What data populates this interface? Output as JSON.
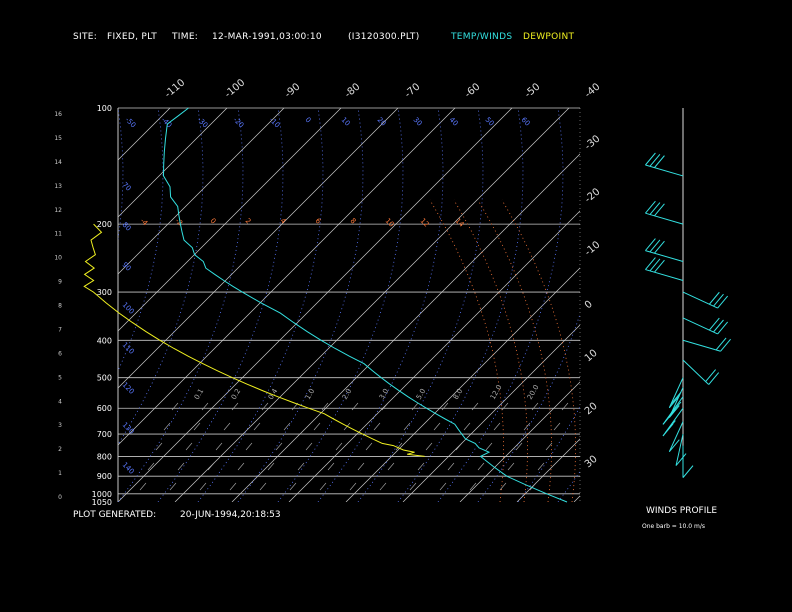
{
  "header": {
    "site_label": "SITE:",
    "site_value": "FIXED, PLT",
    "time_label": "TIME:",
    "time_value": "12-MAR-1991,03:00:10",
    "file_name": "(I3120300.PLT)",
    "legend_temp": "TEMP/WINDS",
    "legend_dew": "DEWPOINT"
  },
  "footer": {
    "generated_label": "PLOT GENERATED:",
    "generated_value": "20-JUN-1994,20:18:53"
  },
  "winds_panel": {
    "title": "WINDS PROFILE",
    "note": "One barb = 10.0 m/s"
  },
  "colors": {
    "temp": "#33e0e0",
    "dew": "#f0f020",
    "grid": "#c8c8c8",
    "dry_adiabat": "#5a78ff",
    "moist_adiabat": "#ff7a3a",
    "mixing_ratio": "#aaaaaa",
    "isotherm_label": "#dddddd",
    "wind": "#33e0e0"
  },
  "chart_data": [
    {
      "type": "line",
      "title": "",
      "pressure_levels": [
        100,
        200,
        300,
        400,
        500,
        600,
        700,
        800,
        900,
        1000,
        1050
      ],
      "height_km_labels": [
        "16",
        "15",
        "14",
        "13",
        "12",
        "11",
        "10",
        "9",
        "8",
        "7",
        "6",
        "5",
        "4",
        "3",
        "2",
        "1",
        "0"
      ],
      "isotherm_labels_top": [
        "-110",
        "-100",
        "-90",
        "-80",
        "-70",
        "-60",
        "-50",
        "-40"
      ],
      "isotherm_labels_right": [
        "-30",
        "-20",
        "-10",
        "0",
        "10",
        "20",
        "30"
      ],
      "dry_adiabat_labels": [
        "-50",
        "-40",
        "-30",
        "-20",
        "-10",
        "0",
        "10",
        "20",
        "30",
        "40",
        "50",
        "60",
        "70",
        "80",
        "90",
        "100",
        "110",
        "120",
        "130",
        "140"
      ],
      "moist_adiabat_labels": [
        "-4",
        "-2",
        "0",
        "2",
        "4",
        "6",
        "8",
        "10",
        "12",
        "14"
      ],
      "mixing_ratio_labels": [
        "0.1",
        "0.2",
        "0.4",
        "1.0",
        "2.0",
        "3.0",
        "5.0",
        "8.0",
        "12.0",
        "20.0"
      ],
      "series": [
        {
          "name": "TEMP",
          "p": [
            1050,
            1000,
            950,
            900,
            850,
            800,
            780,
            760,
            740,
            720,
            700,
            680,
            660,
            640,
            620,
            600,
            580,
            560,
            540,
            520,
            500,
            480,
            460,
            440,
            420,
            400,
            380,
            360,
            340,
            320,
            300,
            290,
            280,
            270,
            260,
            250,
            240,
            230,
            220,
            210,
            200,
            190,
            180,
            170,
            160,
            150,
            140,
            130,
            120,
            110,
            105,
            100
          ],
          "t": [
            25,
            21,
            17,
            13,
            10,
            7,
            8,
            6,
            5,
            3,
            2,
            1,
            0,
            -2,
            -4,
            -6,
            -8,
            -10,
            -12,
            -14,
            -16,
            -18,
            -20,
            -23,
            -26,
            -29,
            -32,
            -35,
            -38,
            -42,
            -46,
            -48,
            -50,
            -52,
            -54,
            -55,
            -57,
            -58,
            -60,
            -61,
            -62,
            -63,
            -64,
            -66,
            -67,
            -69,
            -70,
            -71,
            -72,
            -73,
            -72,
            -71
          ]
        },
        {
          "name": "DEWPOINT",
          "p": [
            800,
            790,
            780,
            770,
            760,
            750,
            740,
            720,
            700,
            680,
            660,
            640,
            620,
            600,
            580,
            560,
            540,
            520,
            500,
            480,
            460,
            440,
            420,
            400,
            380,
            360,
            340,
            320,
            300,
            290,
            280,
            270,
            260,
            250,
            240,
            230,
            220,
            210,
            200
          ],
          "t": [
            -2,
            -5,
            -4,
            -6,
            -7,
            -8,
            -10,
            -12,
            -14,
            -16,
            -18,
            -20,
            -22,
            -25,
            -28,
            -31,
            -34,
            -37,
            -40,
            -43,
            -46,
            -49,
            -52,
            -55,
            -58,
            -61,
            -64,
            -67,
            -70,
            -72,
            -71,
            -73,
            -72,
            -74,
            -73,
            -74,
            -75,
            -74,
            -76
          ]
        }
      ],
      "xlim": [
        -40,
        40
      ],
      "ylim": [
        1050,
        100
      ]
    },
    {
      "type": "scatter",
      "title": "WINDS PROFILE",
      "wind_barbs": [
        {
          "p": 150,
          "dir": 290,
          "speed_ms": 30
        },
        {
          "p": 200,
          "dir": 290,
          "speed_ms": 30
        },
        {
          "p": 250,
          "dir": 290,
          "speed_ms": 25
        },
        {
          "p": 280,
          "dir": 290,
          "speed_ms": 25
        },
        {
          "p": 300,
          "dir": 120,
          "speed_ms": 25
        },
        {
          "p": 350,
          "dir": 120,
          "speed_ms": 30
        },
        {
          "p": 400,
          "dir": 110,
          "speed_ms": 20
        },
        {
          "p": 450,
          "dir": 140,
          "speed_ms": 20
        },
        {
          "p": 500,
          "dir": 200,
          "speed_ms": 15
        },
        {
          "p": 530,
          "dir": 200,
          "speed_ms": 15
        },
        {
          "p": 560,
          "dir": 210,
          "speed_ms": 20
        },
        {
          "p": 600,
          "dir": 210,
          "speed_ms": 15
        },
        {
          "p": 650,
          "dir": 200,
          "speed_ms": 10
        },
        {
          "p": 700,
          "dir": 190,
          "speed_ms": 10
        },
        {
          "p": 750,
          "dir": 180,
          "speed_ms": 10
        }
      ]
    }
  ]
}
